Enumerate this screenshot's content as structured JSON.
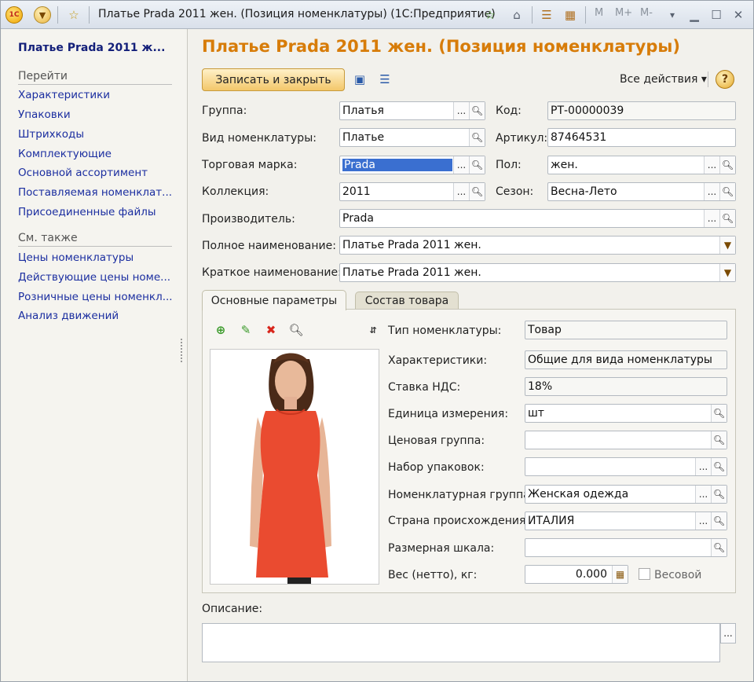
{
  "window": {
    "title": "Платье Prada 2011 жен. (Позиция номенклатуры)   (1С:Предприятие)",
    "logo": "1C",
    "mbuttons": [
      "M",
      "M+",
      "M-"
    ]
  },
  "sidebar": {
    "title": "Платье Prada 2011 ж...",
    "goto_header": "Перейти",
    "goto": [
      "Характеристики",
      "Упаковки",
      "Штрихкоды",
      "Комплектующие",
      "Основной ассортимент",
      "Поставляемая номенклат...",
      "Присоединенные файлы"
    ],
    "see_also_header": "См. также",
    "see_also": [
      "Цены номенклатуры",
      "Действующие цены номе...",
      "Розничные цены номенкл...",
      "Анализ движений"
    ]
  },
  "form": {
    "title": "Платье Prada 2011 жен. (Позиция номенклатуры)",
    "save_close": "Записать и закрыть",
    "all_actions": "Все действия ▾",
    "help": "?",
    "fields": {
      "group_label": "Группа:",
      "group_value": "Платья",
      "code_label": "Код:",
      "code_value": "РТ-00000039",
      "kind_label": "Вид номенклатуры:",
      "kind_value": "Платье",
      "article_label": "Артикул:",
      "article_value": "87464531",
      "brand_label": "Торговая марка:",
      "brand_value": "Prada",
      "gender_label": "Пол:",
      "gender_value": "жен.",
      "collection_label": "Коллекция:",
      "collection_value": "2011",
      "season_label": "Сезон:",
      "season_value": "Весна-Лето",
      "maker_label": "Производитель:",
      "maker_value": "Prada",
      "fullname_label": "Полное наименование:",
      "fullname_value": "Платье Prada 2011 жен.",
      "shortname_label": "Краткое наименование:",
      "shortname_value": "Платье Prada 2011 жен."
    },
    "tabs": [
      "Основные параметры",
      "Состав товара"
    ],
    "params": {
      "type_label": "Тип номенклатуры:",
      "type_value": "Товар",
      "chars_label": "Характеристики:",
      "chars_value": "Общие для вида номенклатуры",
      "vat_label": "Ставка НДС:",
      "vat_value": "18%",
      "unit_label": "Единица измерения:",
      "unit_value": "шт",
      "pricegroup_label": "Ценовая группа:",
      "pricegroup_value": "",
      "pack_label": "Набор упаковок:",
      "pack_value": "",
      "nomgroup_label": "Номенклатурная группа:",
      "nomgroup_value": "Женская одежда",
      "country_label": "Страна происхождения:",
      "country_value": "ИТАЛИЯ",
      "size_label": "Размерная шкала:",
      "size_value": "",
      "weight_label": "Вес (нетто), кг:",
      "weight_value": "0.000",
      "weighted_label": "Весовой"
    },
    "desc_label": "Описание:"
  },
  "colors": {
    "accent": "#d77c09",
    "link": "#1b2ea0",
    "dress": "#ea4b30"
  }
}
